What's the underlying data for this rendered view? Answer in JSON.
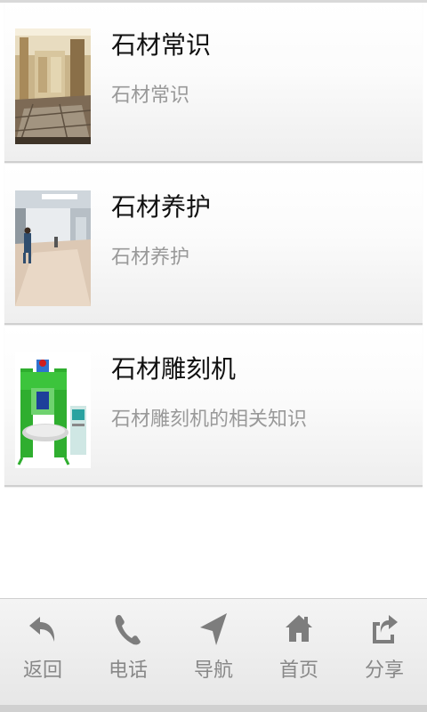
{
  "items": [
    {
      "title": "石材常识",
      "subtitle": "石材常识"
    },
    {
      "title": "石材养护",
      "subtitle": "石材养护"
    },
    {
      "title": "石材雕刻机",
      "subtitle": "石材雕刻机的相关知识"
    }
  ],
  "toolbar": {
    "back": "返回",
    "phone": "电话",
    "navigate": "导航",
    "home": "首页",
    "share": "分享"
  },
  "colors": {
    "title_text": "#111111",
    "subtitle_text": "#999999",
    "toolbar_icon": "#7d7d7d",
    "toolbar_text": "#888888"
  },
  "icons": [
    "back-arrow-icon",
    "phone-icon",
    "navigation-arrow-icon",
    "home-icon",
    "share-icon"
  ]
}
